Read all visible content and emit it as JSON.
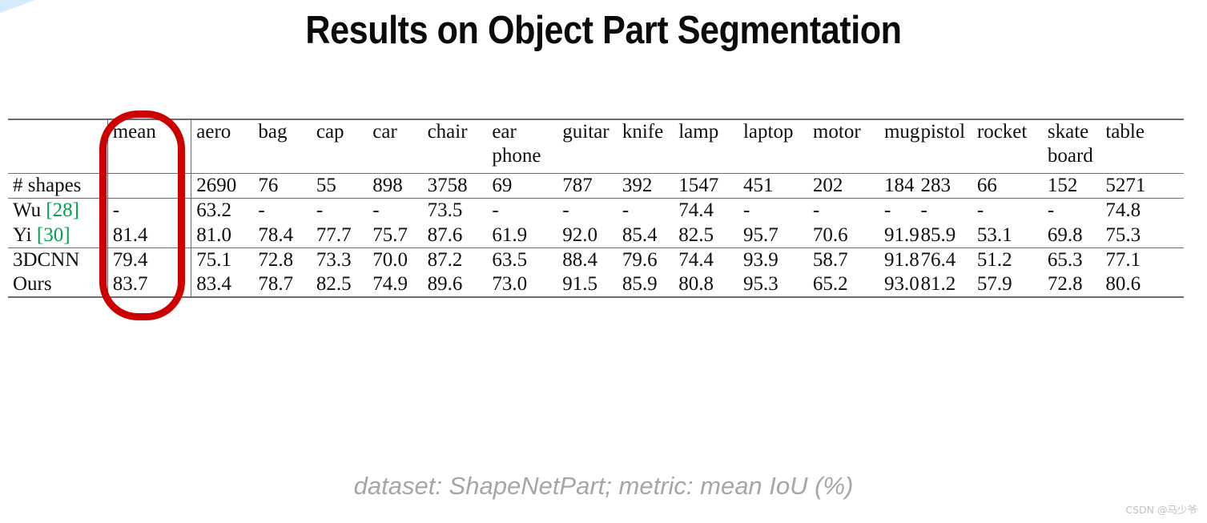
{
  "slide": {
    "title": "Results on Object Part Segmentation",
    "caption": "dataset: ShapeNetPart; metric: mean IoU (%)",
    "watermark": "CSDN @马少爷",
    "accent_red": "#cc0000",
    "citation_green": "#00a14b",
    "corner_blue": "#d3ebfb"
  },
  "chart_data": {
    "type": "table",
    "title": "Results on Object Part Segmentation",
    "caption": "dataset: ShapeNetPart; metric: mean IoU (%)",
    "row_header_label": "",
    "columns": [
      {
        "label": "mean",
        "label2": ""
      },
      {
        "label": "aero",
        "label2": ""
      },
      {
        "label": "bag",
        "label2": ""
      },
      {
        "label": "cap",
        "label2": ""
      },
      {
        "label": "car",
        "label2": ""
      },
      {
        "label": "chair",
        "label2": ""
      },
      {
        "label": "ear",
        "label2": "phone"
      },
      {
        "label": "guitar",
        "label2": ""
      },
      {
        "label": "knife",
        "label2": ""
      },
      {
        "label": "lamp",
        "label2": ""
      },
      {
        "label": "laptop",
        "label2": ""
      },
      {
        "label": "motor",
        "label2": ""
      },
      {
        "label": "mug",
        "label2": ""
      },
      {
        "label": "pistol",
        "label2": ""
      },
      {
        "label": "rocket",
        "label2": ""
      },
      {
        "label": "skate",
        "label2": "board"
      },
      {
        "label": "table",
        "label2": ""
      }
    ],
    "rows": [
      {
        "label": "# shapes",
        "label_cite": "",
        "values": [
          "",
          "2690",
          "76",
          "55",
          "898",
          "3758",
          "69",
          "787",
          "392",
          "1547",
          "451",
          "202",
          "184",
          "283",
          "66",
          "152",
          "5271"
        ],
        "bold": [
          false,
          false,
          false,
          false,
          false,
          false,
          false,
          false,
          false,
          false,
          false,
          false,
          false,
          false,
          false,
          false,
          false
        ]
      },
      {
        "label": "Wu ",
        "label_cite": "[28]",
        "values": [
          "-",
          "63.2",
          "-",
          "-",
          "-",
          "73.5",
          "-",
          "-",
          "-",
          "74.4",
          "-",
          "-",
          "-",
          "-",
          "-",
          "-",
          "74.8"
        ],
        "bold": [
          false,
          false,
          false,
          false,
          false,
          false,
          false,
          false,
          false,
          false,
          false,
          false,
          false,
          false,
          false,
          false,
          false
        ]
      },
      {
        "label": "Yi ",
        "label_cite": "[30]",
        "values": [
          "81.4",
          "81.0",
          "78.4",
          "77.7",
          "75.7",
          "87.6",
          "61.9",
          "92.0",
          "85.4",
          "82.5",
          "95.7",
          "70.6",
          "91.9",
          "85.9",
          "53.1",
          "69.8",
          "75.3"
        ],
        "bold": [
          false,
          false,
          false,
          false,
          true,
          false,
          false,
          true,
          false,
          true,
          true,
          true,
          false,
          true,
          false,
          false,
          false
        ]
      },
      {
        "label": "3DCNN",
        "label_cite": "",
        "values": [
          "79.4",
          "75.1",
          "72.8",
          "73.3",
          "70.0",
          "87.2",
          "63.5",
          "88.4",
          "79.6",
          "74.4",
          "93.9",
          "58.7",
          "91.8",
          "76.4",
          "51.2",
          "65.3",
          "77.1"
        ],
        "bold": [
          false,
          false,
          false,
          false,
          false,
          false,
          false,
          false,
          false,
          false,
          false,
          false,
          false,
          false,
          false,
          false,
          false
        ]
      },
      {
        "label": "Ours",
        "label_cite": "",
        "values": [
          "83.7",
          "83.4",
          "78.7",
          "82.5",
          "74.9",
          "89.6",
          "73.0",
          "91.5",
          "85.9",
          "80.8",
          "95.3",
          "65.2",
          "93.0",
          "81.2",
          "57.9",
          "72.8",
          "80.6"
        ],
        "bold": [
          true,
          true,
          true,
          true,
          false,
          true,
          true,
          false,
          true,
          false,
          false,
          false,
          true,
          false,
          true,
          true,
          true
        ]
      }
    ],
    "highlighted_column": "mean"
  }
}
